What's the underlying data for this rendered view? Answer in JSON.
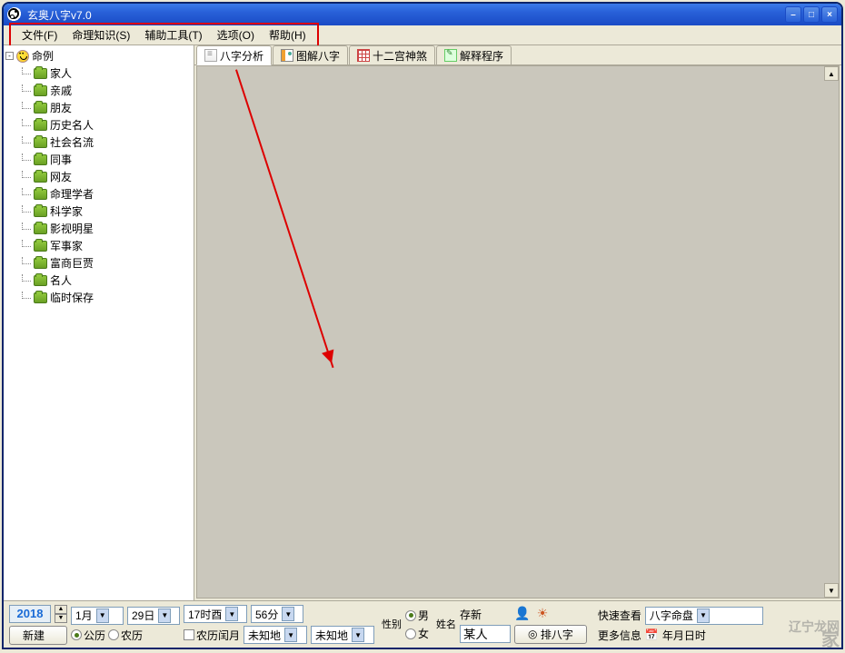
{
  "title": "玄奥八字v7.0",
  "menus": [
    "文件(F)",
    "命理知识(S)",
    "辅助工具(T)",
    "选项(O)",
    "帮助(H)"
  ],
  "tree": {
    "root": "命例",
    "items": [
      "家人",
      "亲戚",
      "朋友",
      "历史名人",
      "社会名流",
      "同事",
      "网友",
      "命理学者",
      "科学家",
      "影视明星",
      "军事家",
      "富商巨贾",
      "名人",
      "临时保存"
    ]
  },
  "tabs": [
    "八字分析",
    "图解八字",
    "十二宫神煞",
    "解释程序"
  ],
  "status": {
    "year": "2018",
    "month": "1月",
    "day": "29日",
    "hour": "17时酉",
    "minute": "56分",
    "new_btn": "新建",
    "cal_solar": "公历",
    "cal_lunar": "农历",
    "cal_leap": "农历闰月",
    "loc1": "未知地",
    "loc2": "未知地",
    "sex_label": "性别",
    "male": "男",
    "female": "女",
    "name_label": "姓名",
    "name_value": "某人",
    "save_new": "存新",
    "paipan_btn": "排八字",
    "quick_label": "快速查看",
    "quick_value": "八字命盘",
    "more_label": "更多信息",
    "date_hint": "年月日时"
  },
  "watermark": {
    "line1": "辽宁龙网",
    "line2": "家"
  }
}
